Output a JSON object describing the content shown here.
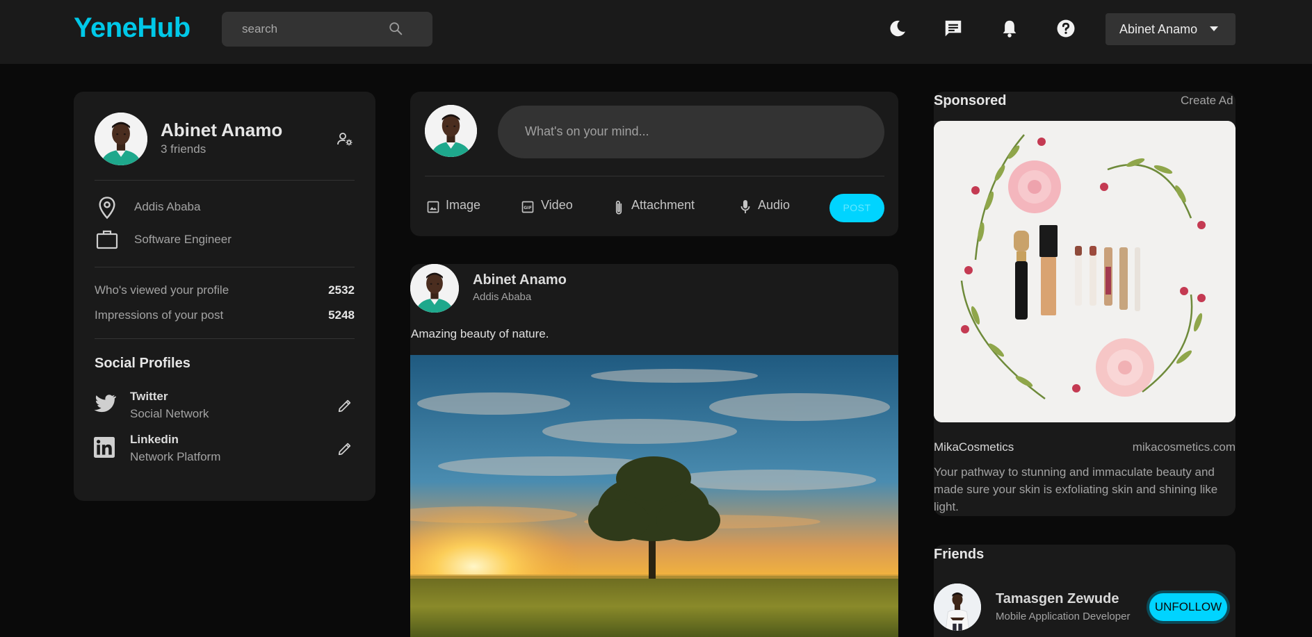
{
  "brand": {
    "name": "YeneHub",
    "accent": "#00c8e8"
  },
  "search": {
    "placeholder": "search"
  },
  "header": {
    "icons": [
      "moon-icon",
      "chat-icon",
      "bell-icon",
      "help-icon"
    ],
    "user_menu_label": "Abinet Anamo"
  },
  "profile": {
    "name": "Abinet Anamo",
    "friends": "3 friends",
    "location": "Addis Ababa",
    "occupation": "Software Engineer",
    "stats": [
      {
        "label": "Who's viewed your profile",
        "value": "2532"
      },
      {
        "label": "Impressions of your post",
        "value": "5248"
      }
    ],
    "social_title": "Social Profiles",
    "social": [
      {
        "name": "Twitter",
        "type": "Social Network"
      },
      {
        "name": "Linkedin",
        "type": "Network Platform"
      }
    ]
  },
  "composer": {
    "placeholder": "What's on your mind...",
    "tools": [
      "Image",
      "Video",
      "Attachment",
      "Audio"
    ],
    "post_label": "POST"
  },
  "post": {
    "author": "Abinet Anamo",
    "location": "Addis Ababa",
    "text": "Amazing beauty of nature."
  },
  "sponsored": {
    "title": "Sponsored",
    "create_ad": "Create Ad",
    "advertiser": "MikaCosmetics",
    "url": "mikacosmetics.com",
    "description": "Your pathway to stunning and immaculate beauty and made sure your skin is exfoliating skin and shining like light."
  },
  "friends": {
    "title": "Friends",
    "list": [
      {
        "name": "Tamasgen Zewude",
        "role": "Mobile Application Developer",
        "action": "UNFOLLOW"
      }
    ]
  }
}
